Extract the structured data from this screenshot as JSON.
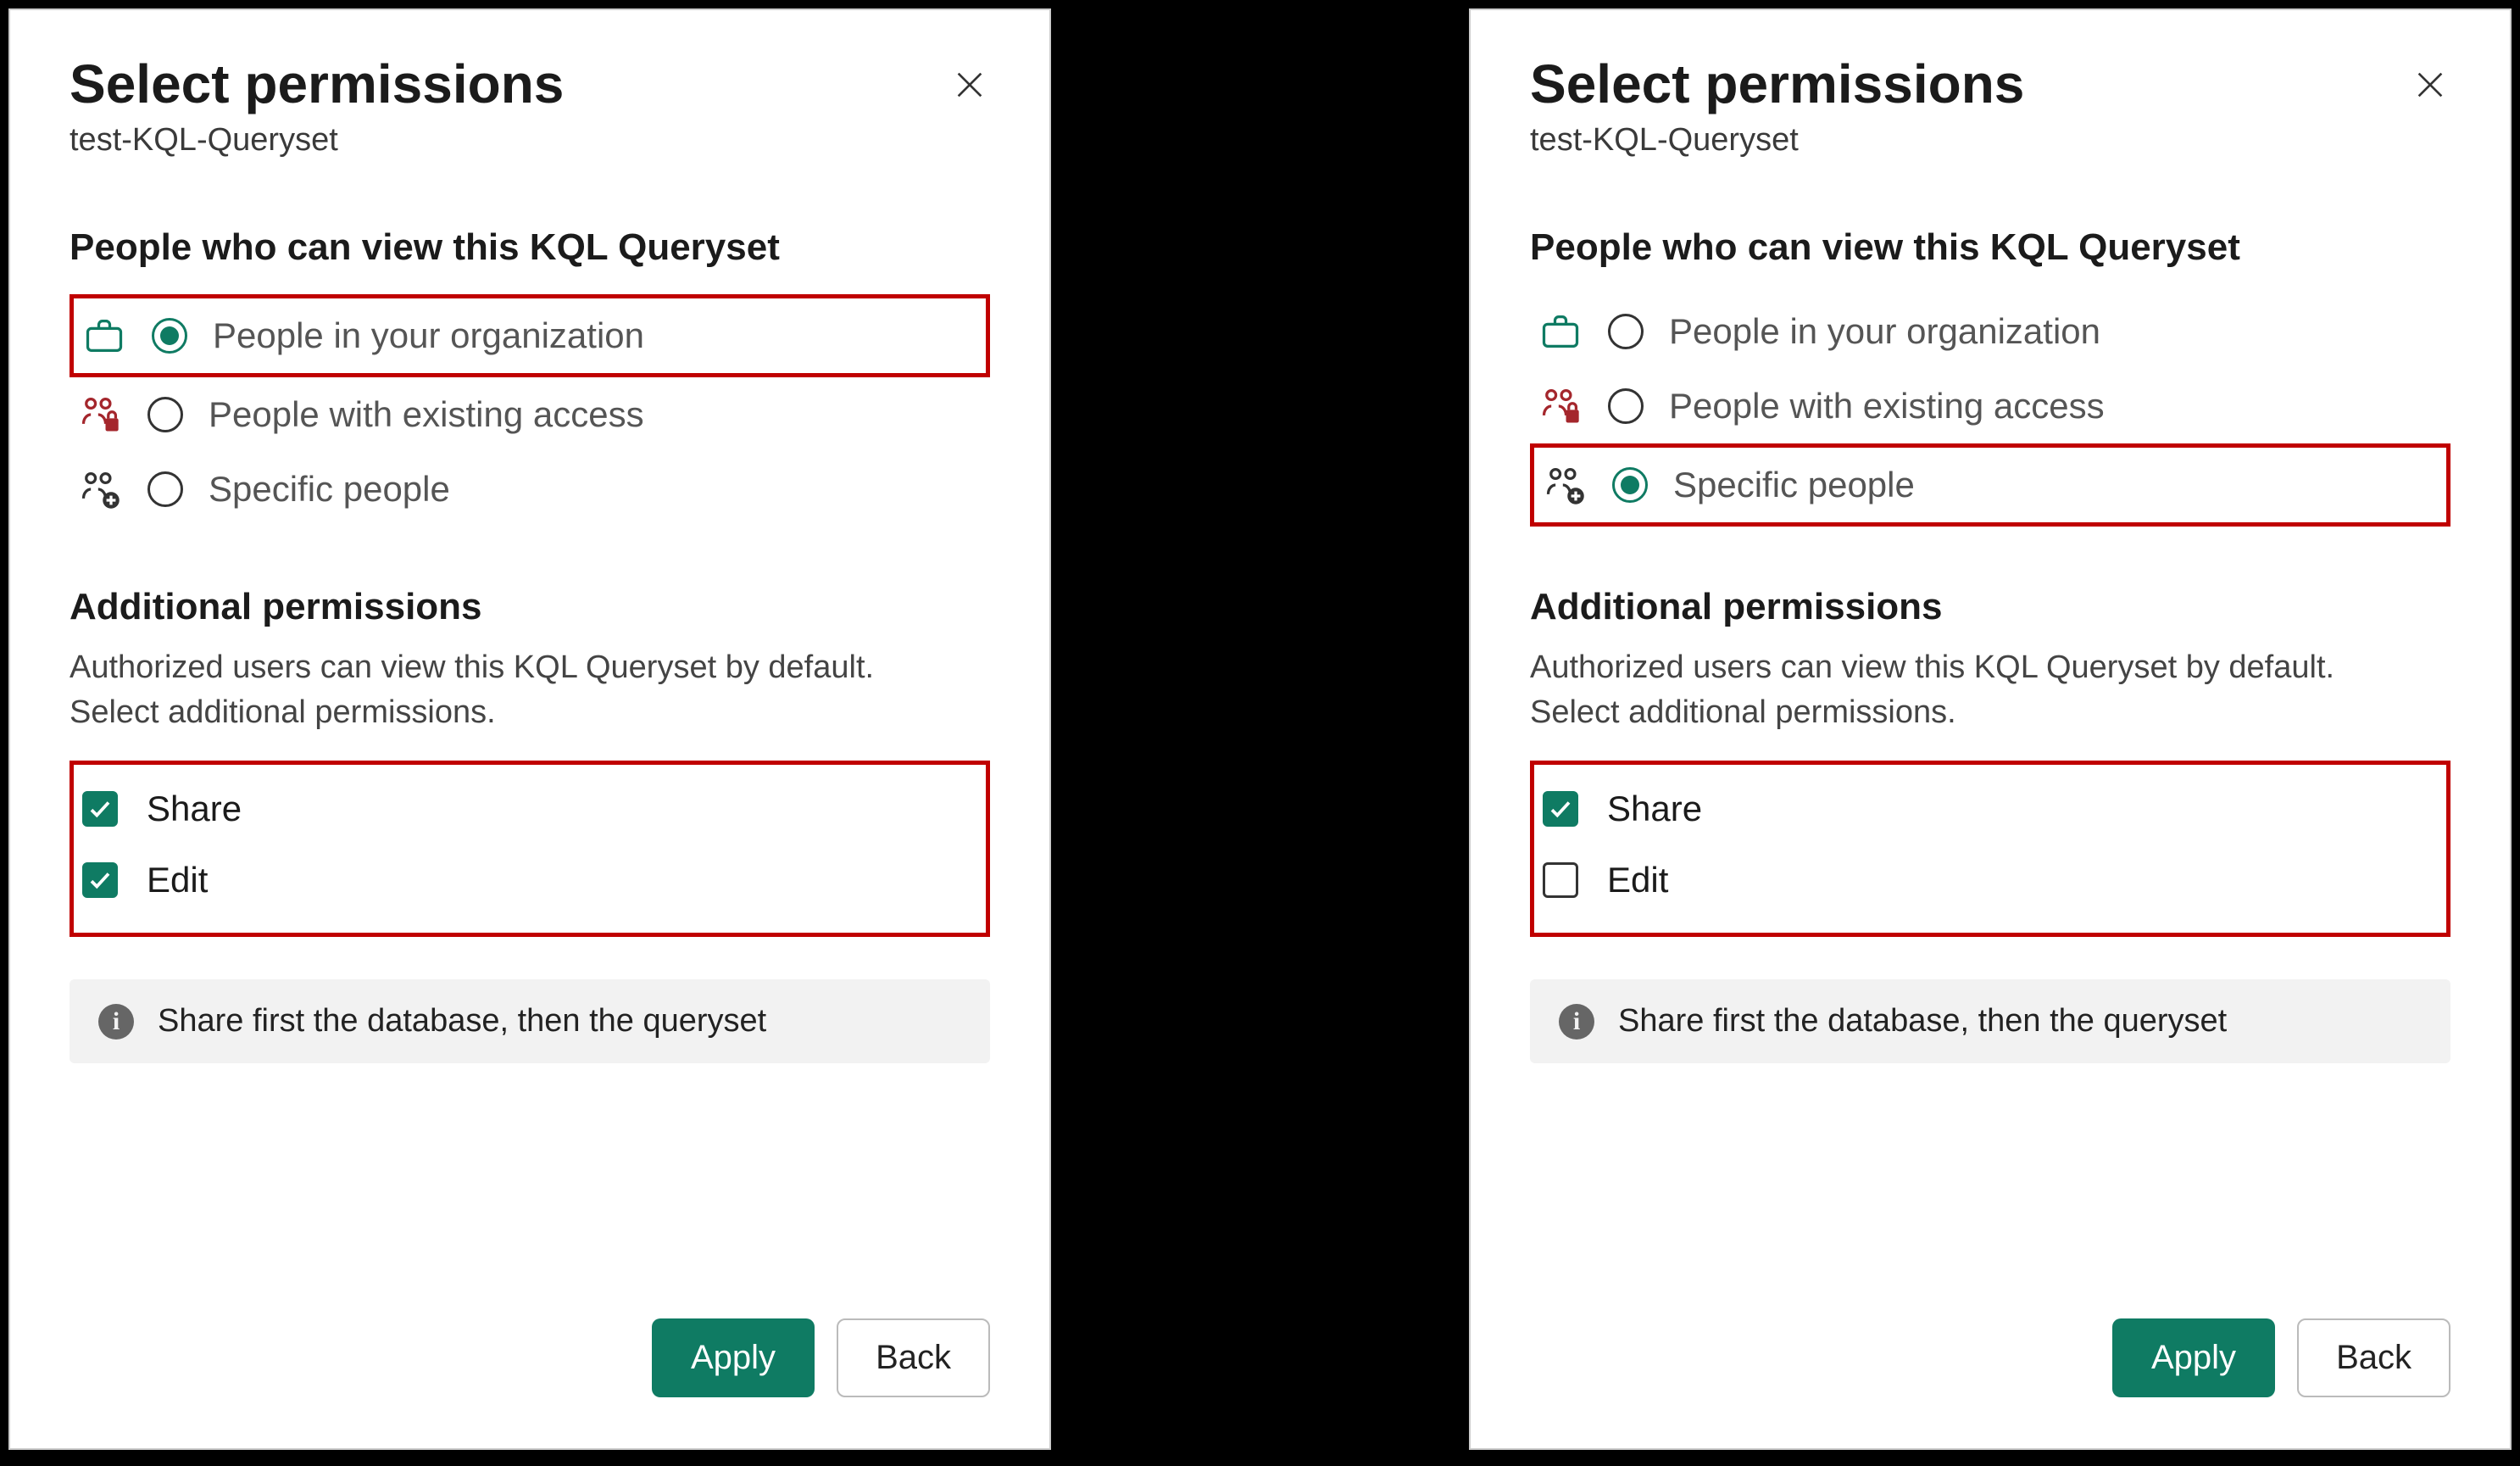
{
  "left": {
    "title": "Select permissions",
    "subtitle": "test-KQL-Queryset",
    "viewers_heading": "People who can view this KQL Queryset",
    "options": {
      "org": "People in your organization",
      "existing": "People with existing access",
      "specific": "Specific people"
    },
    "selected_option": "org",
    "additional_heading": "Additional permissions",
    "additional_help": "Authorized users can view this KQL Queryset by default. Select additional permissions.",
    "share_label": "Share",
    "edit_label": "Edit",
    "share_checked": true,
    "edit_checked": true,
    "info_text": "Share first the database, then the queryset",
    "apply_label": "Apply",
    "back_label": "Back"
  },
  "right": {
    "title": "Select permissions",
    "subtitle": "test-KQL-Queryset",
    "viewers_heading": "People who can view this KQL Queryset",
    "options": {
      "org": "People in your organization",
      "existing": "People with existing access",
      "specific": "Specific people"
    },
    "selected_option": "specific",
    "additional_heading": "Additional permissions",
    "additional_help": "Authorized users can view this KQL Queryset by default. Select additional permissions.",
    "share_label": "Share",
    "edit_label": "Edit",
    "share_checked": true,
    "edit_checked": false,
    "info_text": "Share first the database, then the queryset",
    "apply_label": "Apply",
    "back_label": "Back"
  }
}
